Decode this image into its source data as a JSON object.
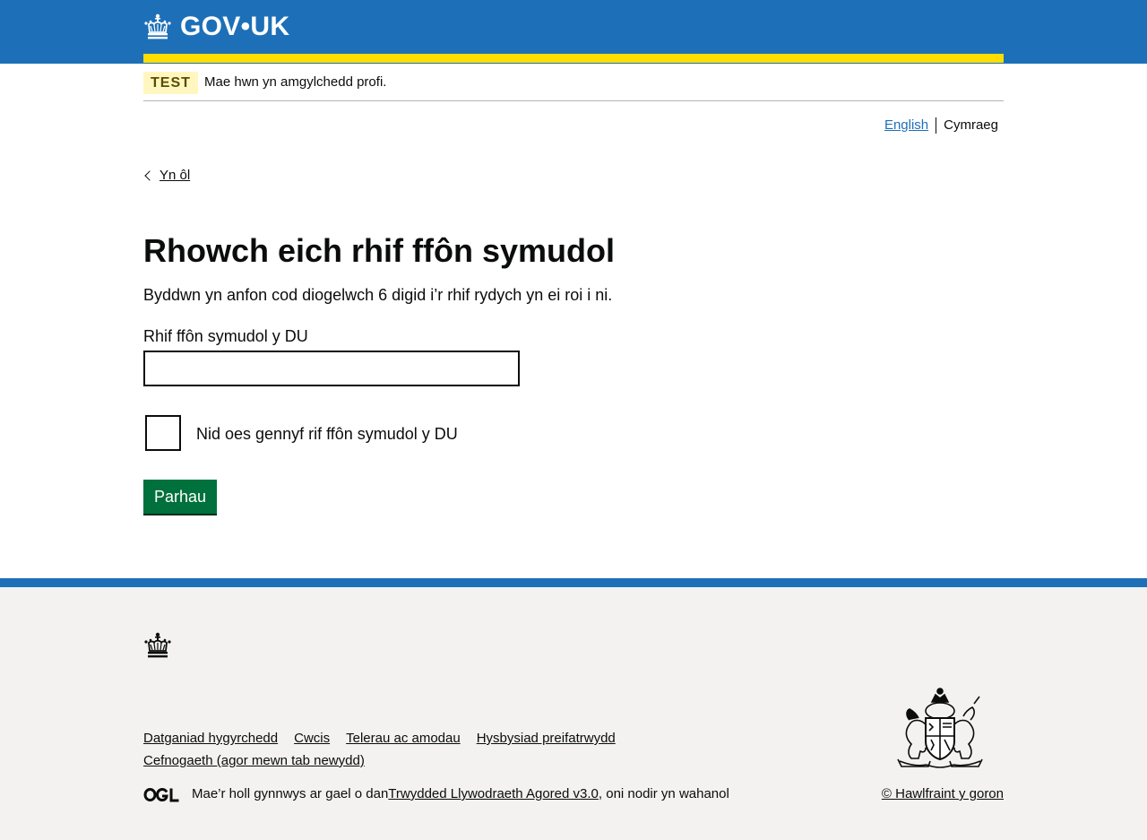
{
  "header": {
    "logo_text_left": "GOV",
    "logo_dot": "•",
    "logo_text_right": "UK"
  },
  "phase_banner": {
    "tag": "TEST",
    "text": "Mae hwn yn amgylchedd profi."
  },
  "language": {
    "english": "English",
    "welsh": "Cymraeg"
  },
  "back_link": {
    "label": "Yn ôl"
  },
  "main": {
    "heading": "Rhowch eich rhif ffôn symudol",
    "lede": "Byddwn yn anfon cod diogelwch 6 digid i’r rhif rydych yn ei roi i ni.",
    "phone_label": "Rhif ffôn symudol y DU",
    "phone_value": "",
    "checkbox_label": "Nid oes gennyf rif ffôn symudol y DU",
    "continue_button": "Parhau"
  },
  "footer": {
    "links": [
      "Datganiad hygyrchedd",
      "Cwcis",
      "Telerau ac amodau",
      "Hysbysiad preifatrwydd",
      "Cefnogaeth (agor mewn tab newydd)"
    ],
    "licence_prefix": "Mae’r holl gynnwys ar gael o dan ",
    "licence_link": "Trwydded Llywodraeth Agored v3.0",
    "licence_suffix": ", oni nodir yn wahanol",
    "copyright": "© Hawlfraint y goron"
  },
  "colors": {
    "header_blue": "#1d70b8",
    "stripe_yellow": "#ffdd00",
    "button_green": "#00703c",
    "footer_grey": "#f3f2f1"
  },
  "icons": [
    "crown-icon",
    "chevron-left-icon",
    "ogl-logo",
    "royal-coat-of-arms"
  ]
}
